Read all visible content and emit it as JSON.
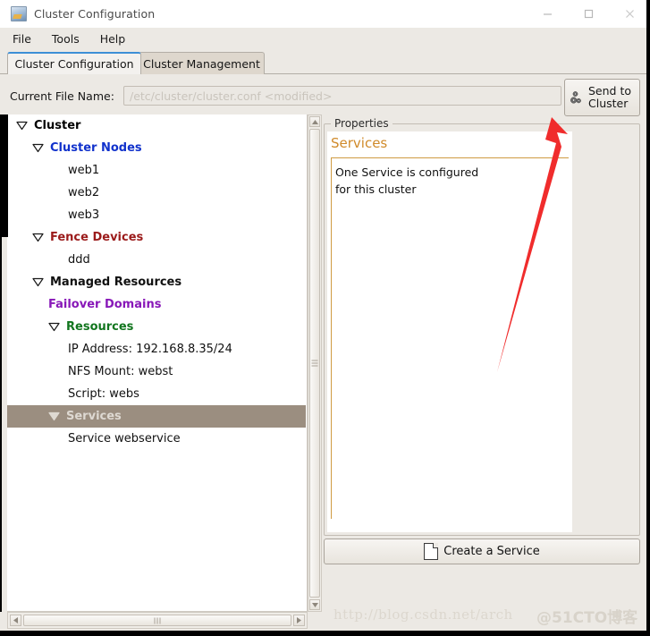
{
  "window": {
    "title": "Cluster Configuration",
    "icon": "app-icon",
    "buttons": {
      "minimize": "minimize-icon",
      "maximize": "maximize-icon",
      "close": "close-icon"
    }
  },
  "menubar": {
    "items": [
      {
        "label": "File"
      },
      {
        "label": "Tools"
      },
      {
        "label": "Help"
      }
    ]
  },
  "tabs": [
    {
      "label": "Cluster Configuration",
      "active": true
    },
    {
      "label": "Cluster Management",
      "active": false
    }
  ],
  "file_row": {
    "label": "Current File Name:",
    "value": "",
    "placeholder": "/etc/cluster/cluster.conf <modified>"
  },
  "send_button": {
    "line1": "Send to",
    "line2": "Cluster",
    "icon": "gears-icon"
  },
  "tree": {
    "items": [
      {
        "label": "Cluster",
        "indent": 0,
        "expander": "down",
        "bold": true,
        "color": "#000000",
        "selected": false
      },
      {
        "label": "Cluster Nodes",
        "indent": 1,
        "expander": "down",
        "bold": true,
        "color": "#1132cc",
        "selected": false
      },
      {
        "label": "web1",
        "indent": 3,
        "expander": "none",
        "bold": false,
        "color": "#111111",
        "selected": false
      },
      {
        "label": "web2",
        "indent": 3,
        "expander": "none",
        "bold": false,
        "color": "#111111",
        "selected": false
      },
      {
        "label": "web3",
        "indent": 3,
        "expander": "none",
        "bold": false,
        "color": "#111111",
        "selected": false
      },
      {
        "label": "Fence Devices",
        "indent": 1,
        "expander": "down",
        "bold": true,
        "color": "#9b1b1b",
        "selected": false
      },
      {
        "label": "ddd",
        "indent": 3,
        "expander": "none",
        "bold": false,
        "color": "#111111",
        "selected": false
      },
      {
        "label": "Managed Resources",
        "indent": 1,
        "expander": "down",
        "bold": true,
        "color": "#111111",
        "selected": false
      },
      {
        "label": "Failover Domains",
        "indent": 2,
        "expander": "none",
        "bold": true,
        "color": "#8818b8",
        "selected": false
      },
      {
        "label": "Resources",
        "indent": 2,
        "expander": "down",
        "bold": true,
        "color": "#12761f",
        "selected": false
      },
      {
        "label": "IP Address:  192.168.8.35/24",
        "indent": 3,
        "expander": "none",
        "bold": false,
        "color": "#111111",
        "selected": false
      },
      {
        "label": "NFS Mount:  webst",
        "indent": 3,
        "expander": "none",
        "bold": false,
        "color": "#111111",
        "selected": false
      },
      {
        "label": "Script:  webs",
        "indent": 3,
        "expander": "none",
        "bold": false,
        "color": "#111111",
        "selected": false
      },
      {
        "label": "Services",
        "indent": 2,
        "expander": "down",
        "bold": true,
        "color": "#ded9d2",
        "selected": true
      },
      {
        "label": "Service webservice",
        "indent": 3,
        "expander": "none",
        "bold": false,
        "color": "#111111",
        "selected": false
      }
    ]
  },
  "properties": {
    "legend": "Properties",
    "heading": "Services",
    "lines": [
      "One Service is configured",
      " for this cluster"
    ]
  },
  "create_button": {
    "label": "Create a Service",
    "icon": "document-icon"
  },
  "watermark": {
    "url": "http://blog.csdn.net/arch",
    "tag": "@51CTO博客"
  },
  "colors": {
    "accent_tab": "#3d8fd6",
    "selection": "#9b8e80",
    "properties_heading": "#d08a2a",
    "arrow": "#f02c2c",
    "panel": "#ece9e4"
  },
  "scrollbars": {
    "vertical": {
      "up": "scroll-up-arrow",
      "down": "scroll-down-arrow"
    },
    "horizontal": {
      "left": "scroll-left-arrow",
      "right": "scroll-right-arrow"
    }
  }
}
